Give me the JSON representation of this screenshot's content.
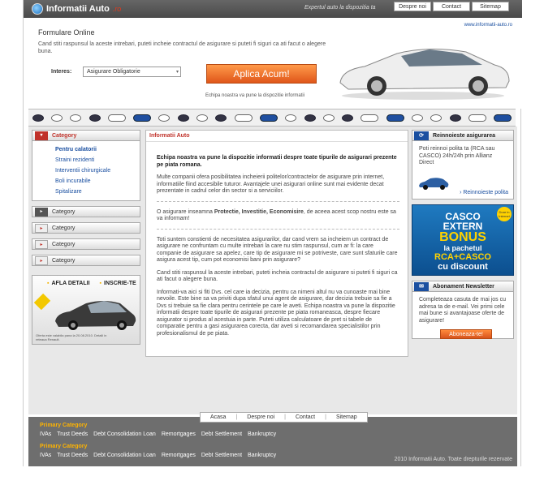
{
  "header": {
    "logo_text": "Informatii Auto",
    "logo_suffix": ".ro",
    "tagline": "Expertul auto la dispozitia ta",
    "nav": [
      "Despre noi",
      "Contact",
      "Sitemap"
    ],
    "site_url": "www.informatii-auto.ro"
  },
  "form": {
    "title": "Formulare Online",
    "description": "Cand stiti raspunsul la aceste intrebari, puteti incheie contractul de asigurare si puteti fi siguri ca ati facut o alegere buna.",
    "interes_label": "Interes:",
    "select_value": "Asigurare Obligatorie",
    "apply_label": "Aplica Acum!",
    "apply_caption": "Echipa noastra va pune la dispozitie informatii"
  },
  "sidebar": {
    "main_category": "Category",
    "subcategories": [
      "Pentru calatorii",
      "Straini rezidenti",
      "Interventii chirurgicale",
      "Boli incurabile",
      "Spitalizare"
    ],
    "other_categories": [
      "Category",
      "Category",
      "Category",
      "Category"
    ],
    "promo": {
      "left": "AFLA DETALII",
      "right": "INSCRIE-TE",
      "fine_print": "Oferta este valabila pana la 20.08.2010. Detalii in reteaua Renault."
    }
  },
  "main": {
    "title": "Informatii Auto",
    "p1": "Echipa noastra va pune la dispozitie informatii despre toate tipurile de asigurari prezente pe piata romana.",
    "p2": "Multe companii ofera posibilitatea incheierii politelor/contractelor de asigurare prin internet, informatiile fiind accesibile tuturor. Avantajele unei asigurari online sunt mai evidente decat prezentate in cadrul celor din sector si a serviciilor.",
    "p3_pre": "O asigurare inseamna ",
    "p3_bold": "Protectie, Investitie, Economisire",
    "p3_post": ", de aceea acest scop nostru este sa va informam!",
    "p4": "Toti suntem constienti de necesitatea asigurarilor, dar cand vrem sa incheiem un contract de asigurare ne confruntam cu multe intrebari la care nu stim raspunsul, cum ar fi: la care companie de asigurare sa apelez, care tip de asigurare mi se potriveste, care sunt sfaturile care asigura acest tip, cum pot economisi bani prin asigurare?",
    "p5": "Cand stiti raspunsul la aceste intrebari, puteti incheia contractul de asigurare si puteti fi siguri ca ati facut o alegere buna.",
    "p6": "Informati-va aici si fiti Dvs. cel care ia decizia, pentru ca nimeni altul nu va cunoaste mai bine nevoile. Este bine sa va priviti dupa sfatul unui agent de asigurare, dar decizia trebuie sa fie a Dvs si trebuie sa fie clara pentru cerintele pe care le aveti. Echipa noastra va pune la dispozitie informatii despre toate tipurile de asigurari prezente pe piata romaneasca, despre fiecare asigurator si produs al acestuia in parte. Puteti utiliza calculatoare de pret si tabele de comparatie pentru a gasi asigurarea corecta, dar aveti si recomandarea specialistilor prin profesionalismul de pe piata."
  },
  "right": {
    "renew_title": "Reinnoieste asigurarea",
    "renew_text": "Poti reinnoi polita ta (RCA sau CASCO) 24h/24h prin Allianz Direct",
    "renew_link": "› Reinnoieste polita",
    "casco": {
      "line1": "CASCO",
      "line2": "EXTERN",
      "line3": "BONUS",
      "line4": "la pachetul",
      "line5": "RCA+CASCO",
      "line6": "cu discount",
      "badge": "Doar in Internet"
    },
    "newsletter_title": "Abonament Newsletter",
    "newsletter_text": "Completeaza casuta de mai jos cu adresa ta de e-mail. Vei primi cele mai bune si avantajoase oferte de asigurare!",
    "newsletter_button": "Aboneaza-te!"
  },
  "footer": {
    "nav": [
      "Acasa",
      "Despre noi",
      "Contact",
      "Sitemap"
    ],
    "primary_category_1": "Primary Category",
    "links_1": [
      "IVAs",
      "Trust Deeds",
      "Debt Consolidation Loan",
      "Remortgages",
      "Debt Settlement",
      "Bankruptcy"
    ],
    "primary_category_2": "Primary Category",
    "links_2": [
      "IVAs",
      "Trust Deeds",
      "Debt Consolidation Loan",
      "Remortgages",
      "Debt Settlement",
      "Bankruptcy"
    ],
    "copyright": "2010 Informatii Auto. Toate drepturile rezervate"
  },
  "colors": {
    "accent": "#c0322a",
    "link": "#1a4fa0",
    "cta": "#e0561a",
    "footer_bg": "#6e6e6e"
  }
}
